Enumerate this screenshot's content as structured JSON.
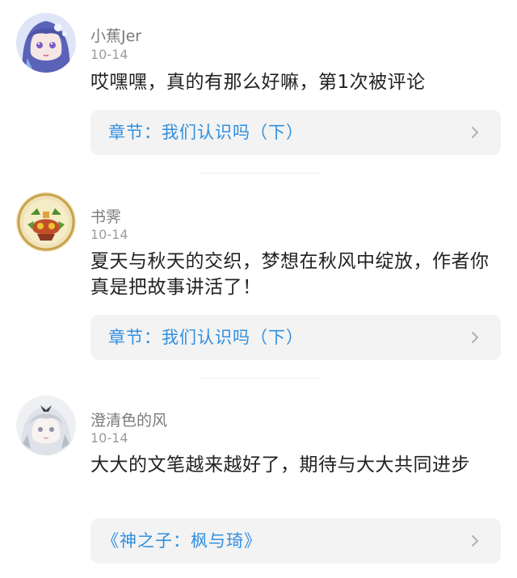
{
  "comments": [
    {
      "user": "小蕉Jer",
      "date": "10-14",
      "text": "哎嘿嘿，真的有那么好嘛，第1次被评论",
      "chapter": "章节：我们认识吗（下）"
    },
    {
      "user": "书霁",
      "date": "10-14",
      "text": "夏天与秋天的交织，梦想在秋风中绽放，作者你真是把故事讲活了！",
      "chapter": "章节：我们认识吗（下）"
    },
    {
      "user": "澄清色的风",
      "date": "10-14",
      "text": "大大的文笔越来越好了，期待与大大共同进步",
      "chapter": "《神之子：枫与琦》"
    }
  ],
  "icons": {
    "chevron": "chevron-right-icon"
  },
  "colors": {
    "link": "#2f8fe0",
    "card_bg": "#f3f3f3"
  }
}
